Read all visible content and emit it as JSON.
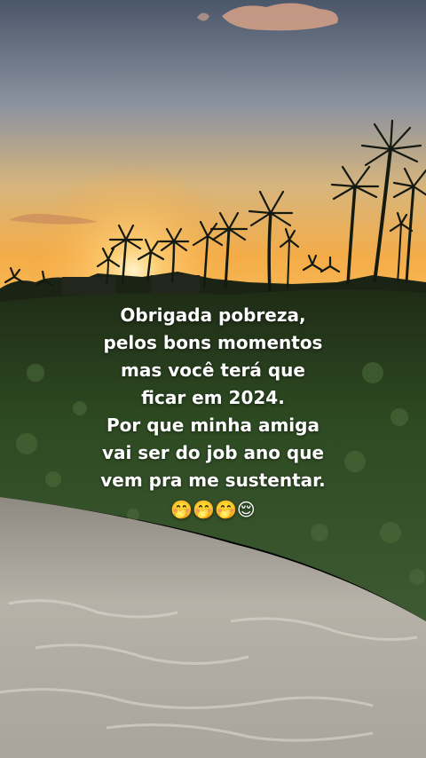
{
  "story": {
    "caption_lines": [
      "Obrigada pobreza,",
      "pelos bons momentos",
      "mas você terá que",
      "ficar em 2024.",
      "Por que minha amiga",
      "vai ser do job ano que",
      "vem pra me sustentar."
    ],
    "emojis": "🤭🤭🤭😌"
  },
  "colors": {
    "sky_top": "#4f5c70",
    "sky_mid": "#c9b07a",
    "horizon": "#f6b552",
    "grass": "#2f4a24",
    "sand": "#b9b3ab"
  }
}
